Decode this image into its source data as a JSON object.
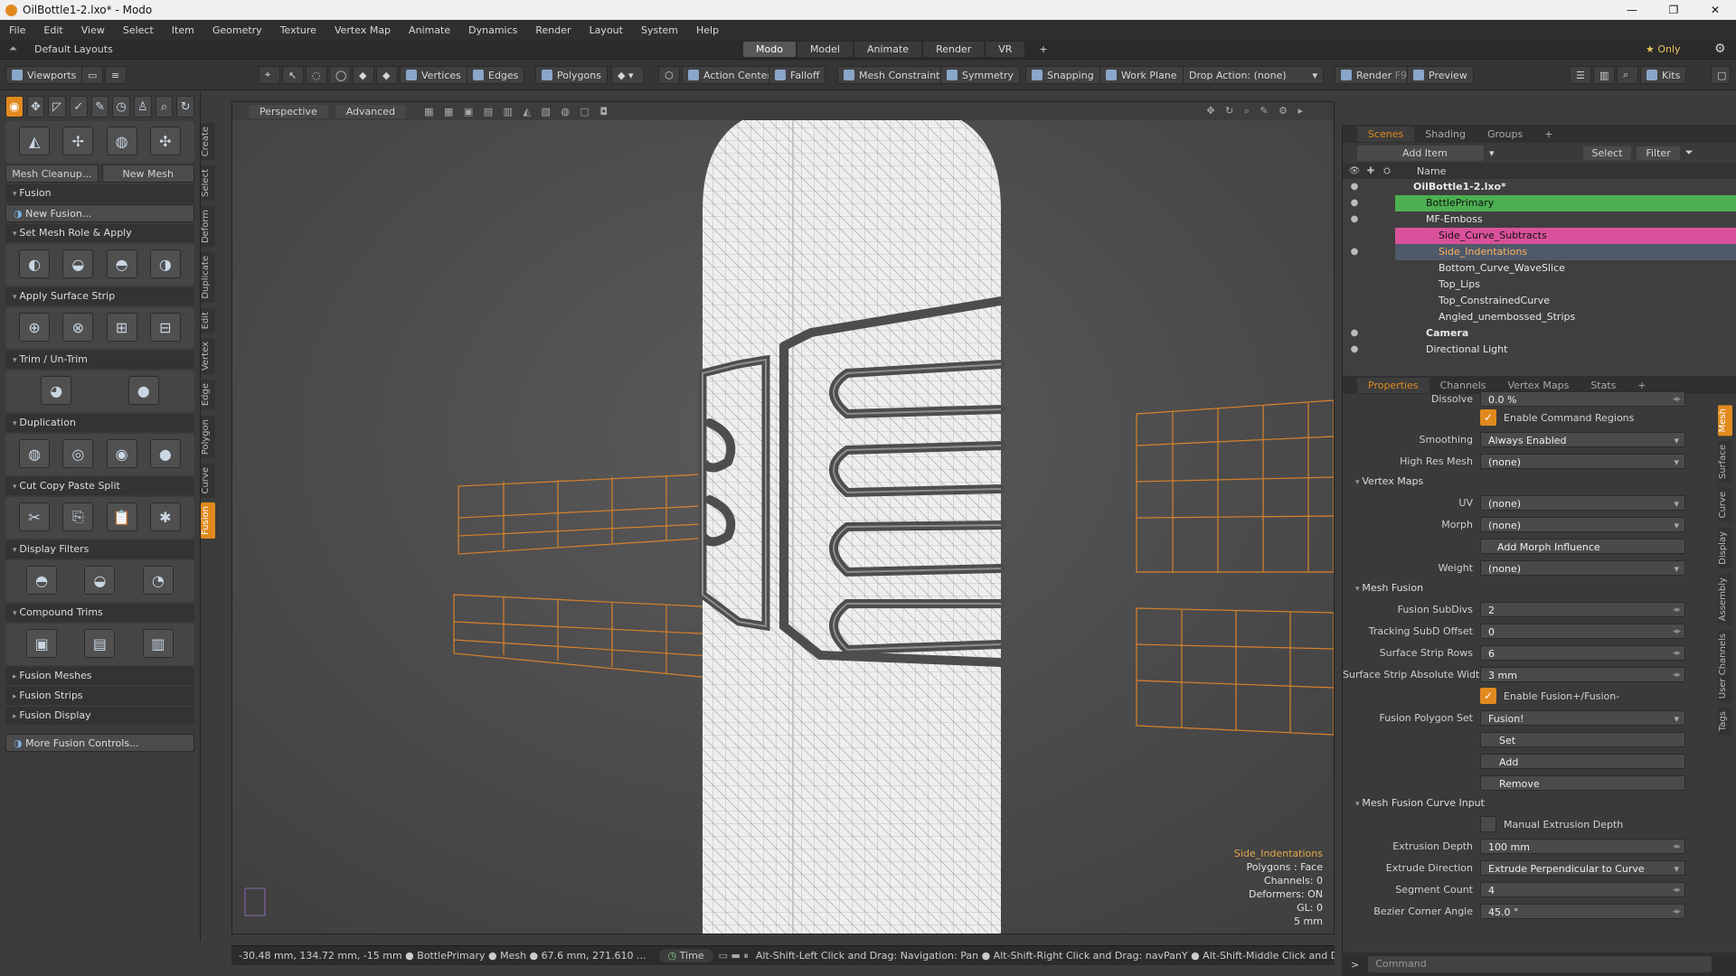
{
  "window": {
    "title": "OilBottle1-2.lxo* - Modo",
    "buttons": [
      "—",
      "❐",
      "✕"
    ]
  },
  "menu": [
    "File",
    "Edit",
    "View",
    "Select",
    "Item",
    "Geometry",
    "Texture",
    "Vertex Map",
    "Animate",
    "Dynamics",
    "Render",
    "Layout",
    "System",
    "Help"
  ],
  "layout": {
    "name": "Default Layouts",
    "tabs": [
      "Modo",
      "Model",
      "Animate",
      "Render",
      "VR"
    ],
    "add": "+",
    "only": "★ Only"
  },
  "toolbar": {
    "viewports": "Viewports",
    "vertices": "Vertices",
    "edges": "Edges",
    "polygons": "Polygons",
    "action_center": "Action Center",
    "falloff": "Falloff",
    "mesh_constraint": "Mesh Constraint",
    "symmetry": "Symmetry",
    "snapping": "Snapping",
    "work_plane": "Work Plane",
    "drop_action": "Drop Action: (none)",
    "render": "Render",
    "render_key": "F9",
    "preview": "Preview",
    "kits": "Kits"
  },
  "left_panel": {
    "mesh_cleanup": "Mesh Cleanup...",
    "new_mesh": "New Mesh",
    "fusion": "Fusion",
    "new_fusion": "New Fusion...",
    "set_mesh_role": "Set Mesh Role & Apply",
    "apply_surface_strip": "Apply Surface Strip",
    "trim": "Trim / Un-Trim",
    "duplication": "Duplication",
    "cut_copy": "Cut Copy Paste Split",
    "display_filters": "Display Filters",
    "compound_trims": "Compound Trims",
    "fusion_meshes": "Fusion Meshes",
    "fusion_strips": "Fusion Strips",
    "fusion_display": "Fusion Display",
    "more_fusion": "More Fusion Controls...",
    "vtabs": [
      "Create",
      "Select",
      "Deform",
      "Duplicate",
      "Edit",
      "Vertex",
      "Edge",
      "Polygon",
      "Curve",
      "Fusion"
    ]
  },
  "viewport": {
    "view": "Perspective",
    "mode": "Advanced",
    "info": {
      "item": "Side_Indentations",
      "polygons": "Polygons : Face",
      "channels": "Channels: 0",
      "deformers": "Deformers: ON",
      "gl": "GL: 0",
      "scale": "5 mm"
    }
  },
  "status": {
    "coords": "-30.48 mm, 134.72 mm, -15 mm ● BottlePrimary ● Mesh ● 67.6 mm, 271.610 ...",
    "time": "Time",
    "hint": "Alt-Shift-Left Click and Drag: Navigation: Pan ● Alt-Shift-Right Click and Drag: navPanY ● Alt-Shift-Middle Click and Drag: navPanX ..."
  },
  "scenes": {
    "tabs": [
      "Scenes",
      "Shading",
      "Groups",
      "+"
    ],
    "add_item": "Add Item",
    "select": "Select",
    "filter": "Filter",
    "name_col": "Name",
    "items": [
      {
        "name": "OilBottle1-2.lxo*",
        "indent": 0,
        "eye": "●",
        "style": "bold"
      },
      {
        "name": "BottlePrimary",
        "indent": 1,
        "eye": "●",
        "style": "green"
      },
      {
        "name": "MF-Emboss",
        "indent": 1,
        "eye": "●",
        "style": ""
      },
      {
        "name": "Side_Curve_Subtracts",
        "indent": 2,
        "eye": "",
        "style": "pink"
      },
      {
        "name": "Side_Indentations",
        "indent": 2,
        "eye": "●",
        "style": "selected"
      },
      {
        "name": "Bottom_Curve_WaveSlice",
        "indent": 2,
        "eye": "",
        "style": ""
      },
      {
        "name": "Top_Lips",
        "indent": 2,
        "eye": "",
        "style": ""
      },
      {
        "name": "Top_ConstrainedCurve",
        "indent": 2,
        "eye": "",
        "style": ""
      },
      {
        "name": "Angled_unembossed_Strips",
        "indent": 2,
        "eye": "",
        "style": ""
      },
      {
        "name": "Camera",
        "indent": 1,
        "eye": "●",
        "style": "bold"
      },
      {
        "name": "Directional Light",
        "indent": 1,
        "eye": "●",
        "style": ""
      }
    ]
  },
  "properties": {
    "tabs": [
      "Properties",
      "Channels",
      "Vertex Maps",
      "Stats",
      "+"
    ],
    "dissolve_label": "Dissolve",
    "dissolve": "0.0 %",
    "enable_command_regions": "Enable Command Regions",
    "smoothing_label": "Smoothing",
    "smoothing": "Always Enabled",
    "high_res_label": "High Res Mesh",
    "high_res": "(none)",
    "vertex_maps": "Vertex Maps",
    "uv_label": "UV",
    "uv": "(none)",
    "morph_label": "Morph",
    "morph": "(none)",
    "add_morph": "Add Morph Influence",
    "weight_label": "Weight",
    "weight": "(none)",
    "mesh_fusion": "Mesh Fusion",
    "fusion_subdivs_label": "Fusion SubDivs",
    "fusion_subdivs": "2",
    "tracking_label": "Tracking SubD Offset",
    "tracking": "0",
    "strip_rows_label": "Surface Strip Rows",
    "strip_rows": "6",
    "strip_width_label": "Surface Strip Absolute Width",
    "strip_width": "3 mm",
    "enable_fusion": "Enable Fusion+/Fusion-",
    "poly_set_label": "Fusion Polygon Set",
    "poly_set": "Fusion!",
    "set": "Set",
    "add": "Add",
    "remove": "Remove",
    "curve_input": "Mesh Fusion Curve Input",
    "manual_depth": "Manual Extrusion Depth",
    "extrusion_depth_label": "Extrusion Depth",
    "extrusion_depth": "100 mm",
    "extrude_dir_label": "Extrude Direction",
    "extrude_dir": "Extrude Perpendicular to Curve",
    "segment_label": "Segment Count",
    "segment": "4",
    "bezier_label": "Bezier Corner Angle",
    "bezier": "45.0 °",
    "sidetabs": [
      "Mesh",
      "Surface",
      "Curve",
      "Display",
      "Assembly",
      "User Channels",
      "Tags"
    ]
  },
  "command": {
    "prompt": ">",
    "placeholder": "Command"
  }
}
